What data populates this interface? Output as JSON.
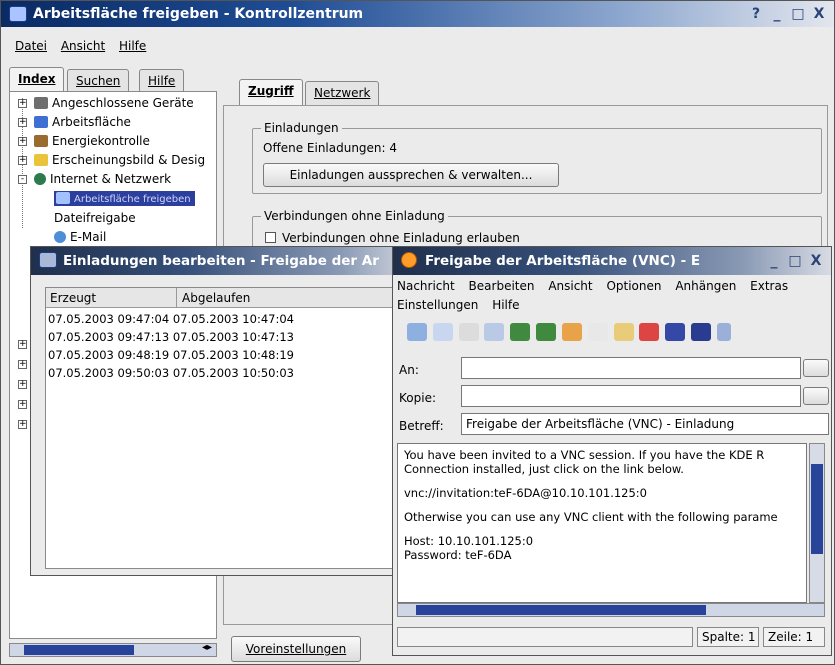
{
  "main_window": {
    "title": "Arbeitsfläche freigeben - Kontrollzentrum",
    "controls": [
      "?",
      "_",
      "□",
      "X"
    ],
    "menu": [
      "Datei",
      "Ansicht",
      "Hilfe"
    ],
    "left_tabs": [
      "Index",
      "Suchen",
      "Hilfe"
    ],
    "tree": {
      "items": [
        "Angeschlossene Geräte",
        "Arbeitsfläche",
        "Energiekontrolle",
        "Erscheinungsbild & Desig",
        "Internet & Netzwerk",
        "Arbeitsfläche freigeben",
        "Dateifreigabe",
        "E-Mail"
      ]
    },
    "right_tabs": [
      "Zugriff",
      "Netzwerk"
    ],
    "invitations_group": {
      "title": "Einladungen",
      "open_label": "Offene Einladungen: 4",
      "manage_button": "Einladungen aussprechen & verwalten..."
    },
    "uninvited_group": {
      "title": "Verbindungen ohne Einladung",
      "checkbox_label": "Verbindungen ohne Einladung erlauben"
    },
    "defaults_button": "Voreinstellungen"
  },
  "invitations_window": {
    "title": "Einladungen bearbeiten - Freigabe der Ar",
    "columns": [
      "Erzeugt",
      "Abgelaufen"
    ],
    "rows": [
      [
        "07.05.2003 09:47:04",
        "07.05.2003 10:47:04"
      ],
      [
        "07.05.2003 09:47:13",
        "07.05.2003 10:47:13"
      ],
      [
        "07.05.2003 09:48:19",
        "07.05.2003 10:48:19"
      ],
      [
        "07.05.2003 09:50:03",
        "07.05.2003 10:50:03"
      ]
    ]
  },
  "mail_window": {
    "title": "Freigabe der Arbeitsfläche (VNC) - E",
    "menu_row1": [
      "Nachricht",
      "Bearbeiten",
      "Ansicht",
      "Optionen",
      "Anhängen",
      "Extras"
    ],
    "menu_row2": [
      "Einstellungen",
      "Hilfe"
    ],
    "to_label": "An:",
    "cc_label": "Kopie:",
    "subject_label": "Betreff:",
    "subject_value": "Freigabe der Arbeitsfläche (VNC) - Einladung",
    "body": [
      "You have been invited to a VNC session. If you have the KDE R",
      "Connection installed, just click on the link below.",
      "vnc://invitation:teF-6DA@10.10.101.125:0",
      "Otherwise you can use any VNC client with the following parame",
      "Host: 10.10.101.125:0",
      "Password: teF-6DA"
    ],
    "status_col": "Spalte: 1",
    "status_row": "Zeile: 1"
  }
}
